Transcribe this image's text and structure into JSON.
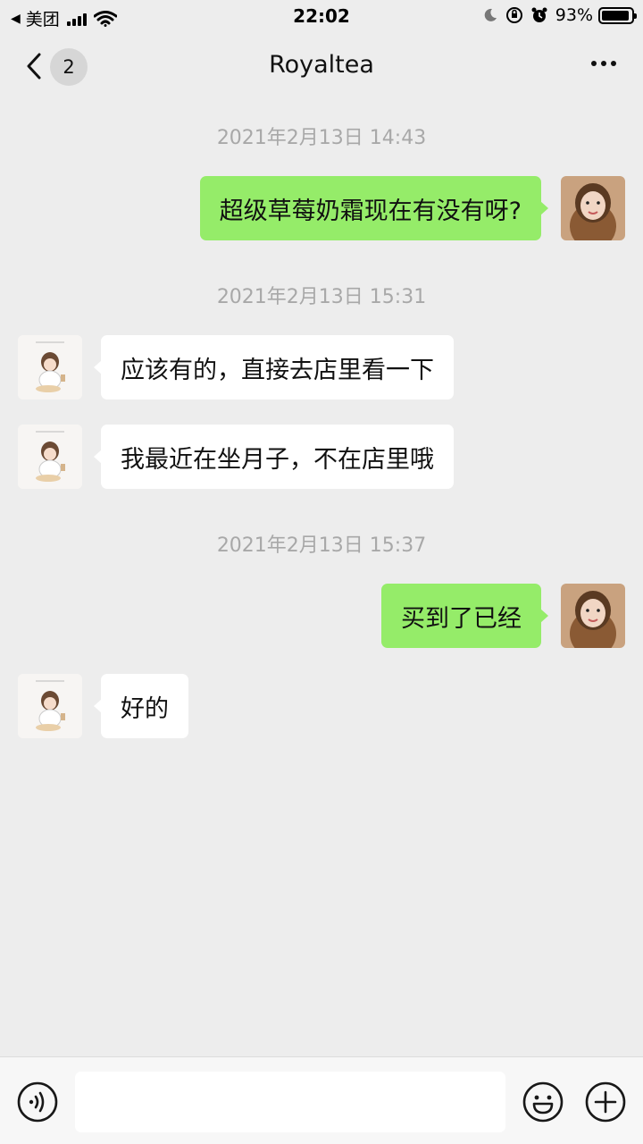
{
  "status_bar": {
    "back_app": "美团",
    "time": "22:02",
    "battery": "93%",
    "battery_level": 0.93
  },
  "nav": {
    "unread_count": "2",
    "title": "Royaltea"
  },
  "messages": [
    {
      "type": "timestamp",
      "text": "2021年2月13日 14:43"
    },
    {
      "type": "message",
      "from": "self",
      "text": "超级草莓奶霜现在有没有呀?"
    },
    {
      "type": "timestamp",
      "text": "2021年2月13日 15:31"
    },
    {
      "type": "message",
      "from": "other",
      "text": "应该有的，直接去店里看一下"
    },
    {
      "type": "message",
      "from": "other",
      "text": "我最近在坐月子，不在店里哦"
    },
    {
      "type": "timestamp",
      "text": "2021年2月13日 15:37"
    },
    {
      "type": "message",
      "from": "self",
      "text": "买到了已经"
    },
    {
      "type": "message",
      "from": "other",
      "text": "好的"
    }
  ],
  "input_bar": {
    "voice_icon": "voice-icon",
    "emoji_icon": "emoji-icon",
    "plus_icon": "plus-icon",
    "value": ""
  },
  "colors": {
    "background": "#ededed",
    "self_bubble": "#95ec69",
    "other_bubble": "#ffffff",
    "timestamp": "#a8a8a8"
  }
}
